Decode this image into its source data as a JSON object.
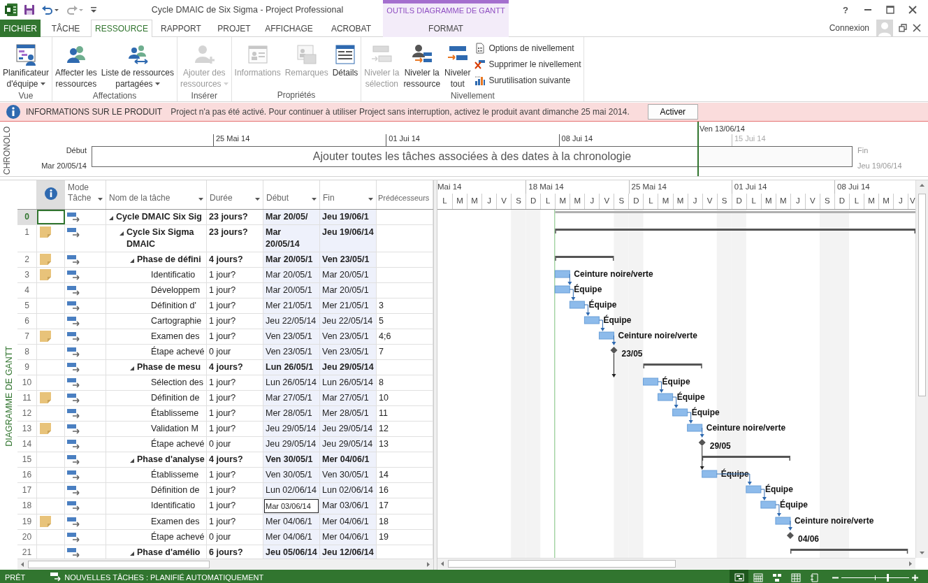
{
  "title_bar": {
    "title": "Cycle DMAIC de Six Sigma - Project Professional",
    "contextual_group": "OUTILS DIAGRAMME DE GANTT",
    "help": "?"
  },
  "tabs": [
    {
      "label": "FICHIER",
      "kind": "file",
      "selected": false
    },
    {
      "label": "TÂCHE",
      "kind": "normal",
      "selected": false
    },
    {
      "label": "RESSOURCE",
      "kind": "normal",
      "selected": true
    },
    {
      "label": "RAPPORT",
      "kind": "normal",
      "selected": false
    },
    {
      "label": "PROJET",
      "kind": "normal",
      "selected": false
    },
    {
      "label": "AFFICHAGE",
      "kind": "normal",
      "selected": false
    },
    {
      "label": "ACROBAT",
      "kind": "normal",
      "selected": false
    },
    {
      "label": "FORMAT",
      "kind": "contextual",
      "selected": false
    }
  ],
  "account": {
    "label": "Connexion"
  },
  "ribbon": {
    "groups": [
      {
        "label": "Vue",
        "buttons": [
          {
            "lines": [
              "Planificateur",
              "d'équipe"
            ],
            "dropdown": true,
            "disabled": false
          }
        ]
      },
      {
        "label": "Affectations",
        "buttons": [
          {
            "lines": [
              "Affecter les",
              "ressources"
            ],
            "dropdown": false,
            "disabled": false
          },
          {
            "lines": [
              "Liste de ressources",
              "partagées"
            ],
            "dropdown": true,
            "disabled": false
          }
        ]
      },
      {
        "label": "Insérer",
        "buttons": [
          {
            "lines": [
              "Ajouter des",
              "ressources"
            ],
            "dropdown": true,
            "disabled": true
          }
        ]
      },
      {
        "label": "Propriétés",
        "buttons": [
          {
            "lines": [
              "Informations"
            ],
            "dropdown": false,
            "disabled": true
          },
          {
            "lines": [
              "Remarques"
            ],
            "dropdown": false,
            "disabled": true
          },
          {
            "lines": [
              "Détails"
            ],
            "dropdown": false,
            "disabled": false
          }
        ]
      },
      {
        "label": "Nivellement",
        "buttons": [
          {
            "lines": [
              "Niveler la",
              "sélection"
            ],
            "dropdown": false,
            "disabled": true
          },
          {
            "lines": [
              "Niveler la",
              "ressource"
            ],
            "dropdown": false,
            "disabled": false
          },
          {
            "lines": [
              "Niveler",
              "tout"
            ],
            "dropdown": false,
            "disabled": false
          }
        ],
        "small_buttons": [
          {
            "label": "Options de nivellement"
          },
          {
            "label": "Supprimer le nivellement"
          },
          {
            "label": "Surutilisation suivante"
          }
        ]
      }
    ]
  },
  "info_bar": {
    "title": "INFORMATIONS SUR LE PRODUIT",
    "message": "Project n'a pas été activé. Pour continuer à utiliser Project sans interruption, activez le produit avant dimanche 25 mai 2014.",
    "button": "Activer"
  },
  "timeline": {
    "side_label": "CHRONOLO",
    "start_label": "Début",
    "start_date": "Mar 20/05/14",
    "ticks": [
      {
        "label": "25 Mai 14",
        "muted": false
      },
      {
        "label": "01 Jui 14",
        "muted": false
      },
      {
        "label": "08 Jui 14",
        "muted": false
      },
      {
        "label": "15 Jui 14",
        "muted": true
      }
    ],
    "today_label": "Ven 13/06/14",
    "placeholder": "Ajouter toutes les tâches associées à des dates à la chronologie",
    "end_label": "Fin",
    "end_date": "Jeu 19/06/14"
  },
  "side_label": "DIAGRAMME DE GANTT",
  "table": {
    "columns": [
      {
        "kind": "indicators"
      },
      {
        "kind": "mode",
        "label": "Mode Tâche",
        "dropdown": true
      },
      {
        "kind": "name",
        "label": "Nom de la tâche",
        "dropdown": true
      },
      {
        "kind": "duration",
        "label": "Durée",
        "dropdown": true
      },
      {
        "kind": "start",
        "label": "Début",
        "dropdown": true
      },
      {
        "kind": "finish",
        "label": "Fin",
        "dropdown": true
      },
      {
        "kind": "predecessors",
        "label": "Prédécesseurs",
        "dropdown": false
      }
    ],
    "rows": [
      {
        "id": "0",
        "kind": "project",
        "name": "Cycle DMAIC Six Sig",
        "duration": "23 jours?",
        "start": "Mar 20/05/",
        "finish": "Jeu 19/06/1",
        "note": false,
        "selected": true,
        "editing": false,
        "expanded": true,
        "children": [
          {
            "id": "1",
            "kind": "summary",
            "name": "Cycle Six Sigma DMAIC",
            "duration": "23 jours?",
            "start": "Mar 20/05/14",
            "finish": "Jeu 19/06/14",
            "note": true,
            "selected": false,
            "editing": false,
            "expanded": true,
            "children": [
              {
                "id": "2",
                "kind": "summary",
                "name": "Phase de défini",
                "duration": "4 jours?",
                "start": "Mar 20/05/1",
                "finish": "Ven 23/05/1",
                "note": true,
                "selected": false,
                "editing": false,
                "expanded": true,
                "children": [
                  {
                    "id": "3",
                    "kind": "task",
                    "name": "Identificatio",
                    "duration": "1 jour?",
                    "start": "Mar 20/05/1",
                    "finish": "Mar 20/05/1",
                    "note": true,
                    "selected": false,
                    "editing": false,
                    "resource": "Ceinture noire/verte"
                  },
                  {
                    "id": "4",
                    "kind": "task",
                    "name": "Développem",
                    "duration": "1 jour?",
                    "start": "Mar 20/05/1",
                    "finish": "Mar 20/05/1",
                    "note": false,
                    "selected": false,
                    "editing": false,
                    "resource": "Équipe"
                  },
                  {
                    "id": "5",
                    "kind": "task",
                    "name": "Définition d'",
                    "duration": "1 jour?",
                    "start": "Mer 21/05/1",
                    "finish": "Mer 21/05/1",
                    "predecessors": "3",
                    "note": false,
                    "selected": false,
                    "editing": false,
                    "resource": "Équipe"
                  },
                  {
                    "id": "6",
                    "kind": "task",
                    "name": "Cartographie",
                    "duration": "1 jour?",
                    "start": "Jeu 22/05/14",
                    "finish": "Jeu 22/05/14",
                    "predecessors": "5",
                    "note": false,
                    "selected": false,
                    "editing": false,
                    "resource": "Équipe"
                  },
                  {
                    "id": "7",
                    "kind": "task",
                    "name": "Examen des",
                    "duration": "1 jour?",
                    "start": "Ven 23/05/1",
                    "finish": "Ven 23/05/1",
                    "predecessors": "4;6",
                    "note": true,
                    "selected": false,
                    "editing": false,
                    "resource": "Ceinture noire/verte"
                  },
                  {
                    "id": "8",
                    "kind": "milestone",
                    "name": "Étape achevé",
                    "duration": "0 jour",
                    "start": "Ven 23/05/1",
                    "finish": "Ven 23/05/1",
                    "predecessors": "7",
                    "note": false,
                    "selected": false,
                    "editing": false,
                    "date_label": "23/05"
                  }
                ]
              },
              {
                "id": "9",
                "kind": "summary",
                "name": "Phase de mesu",
                "duration": "4 jours?",
                "start": "Lun 26/05/1",
                "finish": "Jeu 29/05/14",
                "note": false,
                "selected": false,
                "editing": false,
                "expanded": true,
                "children": [
                  {
                    "id": "10",
                    "kind": "task",
                    "name": "Sélection des",
                    "duration": "1 jour?",
                    "start": "Lun 26/05/14",
                    "finish": "Lun 26/05/14",
                    "predecessors": "8",
                    "note": false,
                    "selected": false,
                    "editing": false,
                    "resource": "Équipe"
                  },
                  {
                    "id": "11",
                    "kind": "task",
                    "name": "Définition de",
                    "duration": "1 jour?",
                    "start": "Mar 27/05/1",
                    "finish": "Mar 27/05/1",
                    "predecessors": "10",
                    "note": true,
                    "selected": false,
                    "editing": false,
                    "resource": "Équipe"
                  },
                  {
                    "id": "12",
                    "kind": "task",
                    "name": "Établisseme",
                    "duration": "1 jour?",
                    "start": "Mer 28/05/1",
                    "finish": "Mer 28/05/1",
                    "predecessors": "11",
                    "note": false,
                    "selected": false,
                    "editing": false,
                    "resource": "Équipe"
                  },
                  {
                    "id": "13",
                    "kind": "task",
                    "name": "Validation M",
                    "duration": "1 jour?",
                    "start": "Jeu 29/05/14",
                    "finish": "Jeu 29/05/14",
                    "predecessors": "12",
                    "note": true,
                    "selected": false,
                    "editing": false,
                    "resource": "Ceinture noire/verte"
                  },
                  {
                    "id": "14",
                    "kind": "milestone",
                    "name": "Étape achevé",
                    "duration": "0 jour",
                    "start": "Jeu 29/05/14",
                    "finish": "Jeu 29/05/14",
                    "predecessors": "13",
                    "note": false,
                    "selected": false,
                    "editing": false,
                    "date_label": "29/05"
                  }
                ]
              },
              {
                "id": "15",
                "kind": "summary",
                "name": "Phase d'analyse",
                "duration": "4 jours?",
                "start": "Ven 30/05/1",
                "finish": "Mer 04/06/1",
                "note": false,
                "selected": false,
                "editing": false,
                "expanded": true,
                "children": [
                  {
                    "id": "16",
                    "kind": "task",
                    "name": "Établisseme",
                    "duration": "1 jour?",
                    "start": "Ven 30/05/1",
                    "finish": "Ven 30/05/1",
                    "predecessors": "14",
                    "note": false,
                    "selected": false,
                    "editing": false,
                    "resource": "Équipe"
                  },
                  {
                    "id": "17",
                    "kind": "task",
                    "name": "Définition de",
                    "duration": "1 jour?",
                    "start": "Lun 02/06/14",
                    "finish": "Lun 02/06/14",
                    "predecessors": "16",
                    "note": false,
                    "selected": false,
                    "editing": false,
                    "resource": "Équipe"
                  },
                  {
                    "id": "18",
                    "kind": "task",
                    "name": "Identificatio",
                    "duration": "1 jour?",
                    "start": "Mar 03/06/14",
                    "finish": "Mar 03/06/1",
                    "predecessors": "17",
                    "note": false,
                    "selected": false,
                    "editing": true,
                    "resource": "Équipe"
                  },
                  {
                    "id": "19",
                    "kind": "task",
                    "name": "Examen des",
                    "duration": "1 jour?",
                    "start": "Mer 04/06/1",
                    "finish": "Mer 04/06/1",
                    "predecessors": "18",
                    "note": true,
                    "selected": false,
                    "editing": false,
                    "resource": "Ceinture noire/verte"
                  },
                  {
                    "id": "20",
                    "kind": "milestone",
                    "name": "Étape achevé",
                    "duration": "0 jour",
                    "start": "Mer 04/06/1",
                    "finish": "Mer 04/06/1",
                    "predecessors": "19",
                    "note": false,
                    "selected": false,
                    "editing": false,
                    "date_label": "04/06"
                  }
                ]
              },
              {
                "id": "21",
                "kind": "summary",
                "name": "Phase d'amélio",
                "duration": "6 jours?",
                "start": "Jeu 05/06/14",
                "finish": "Jeu 12/06/14",
                "note": false,
                "selected": false,
                "editing": false,
                "expanded": true
              }
            ]
          }
        ]
      }
    ]
  },
  "gantt": {
    "weeks": [
      "Mai 14",
      "18 Mai 14",
      "25 Mai 14",
      "01 Jui 14",
      "08 Jui 14"
    ],
    "days": [
      "L",
      "M",
      "M",
      "J",
      "V",
      "S",
      "D",
      "L",
      "M",
      "M",
      "J",
      "V",
      "S",
      "D",
      "L",
      "M",
      "M",
      "J",
      "V",
      "S",
      "D",
      "L",
      "M",
      "M",
      "J",
      "V",
      "S",
      "D",
      "L",
      "M",
      "M",
      "J",
      "V"
    ]
  },
  "status_bar": {
    "ready": "PRÊT",
    "new_tasks": "NOUVELLES TÂCHES : PLANIFIÉ AUTOMATIQUEMENT",
    "views": [
      {
        "selected": true
      },
      {
        "selected": false
      },
      {
        "selected": false
      },
      {
        "selected": false
      },
      {
        "selected": false
      }
    ],
    "zoom": {
      "level": 0.68
    }
  }
}
